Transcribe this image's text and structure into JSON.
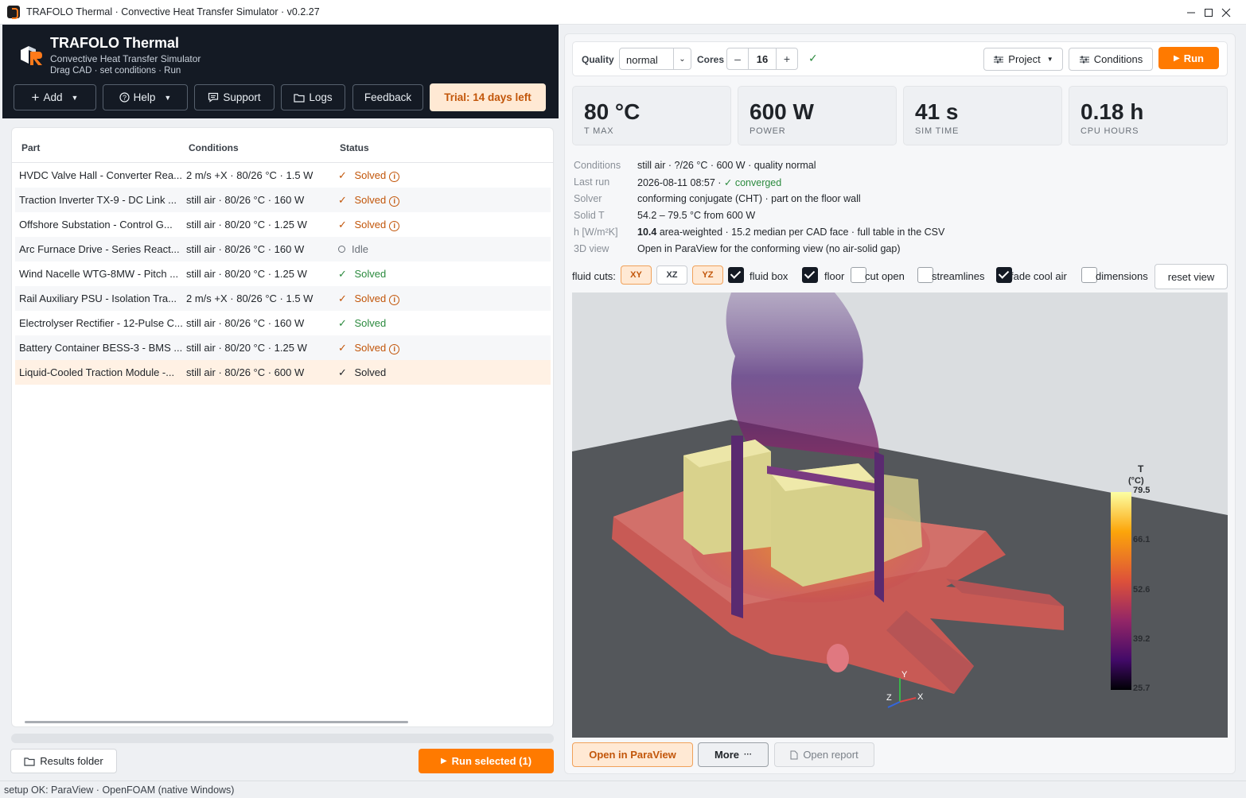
{
  "window": {
    "title": "TRAFOLO Thermal · Convective Heat Transfer Simulator · v0.2.27"
  },
  "header": {
    "app_name": "TRAFOLO Thermal",
    "subtitle": "Convective Heat Transfer Simulator",
    "tagline": "Drag CAD · set conditions · Run",
    "buttons": {
      "add": "Add",
      "help": "Help",
      "support": "Support",
      "logs": "Logs",
      "feedback": "Feedback",
      "trial": "Trial: 14 days left"
    }
  },
  "table": {
    "columns": [
      "Part",
      "Conditions",
      "Status"
    ],
    "rows": [
      {
        "part": "HVDC Valve Hall - Converter Rea...",
        "conditions": "2 m/s +X · 80/26 °C · 1.5 W",
        "status": "Solved",
        "kind": "warn"
      },
      {
        "part": "Traction Inverter TX-9 - DC Link ...",
        "conditions": "still air · 80/26 °C · 160 W",
        "status": "Solved",
        "kind": "warn"
      },
      {
        "part": "Offshore Substation - Control G...",
        "conditions": "still air · 80/20 °C · 1.25 W",
        "status": "Solved",
        "kind": "warn"
      },
      {
        "part": "Arc Furnace Drive - Series React...",
        "conditions": "still air · 80/26 °C · 160 W",
        "status": "Idle",
        "kind": "idle"
      },
      {
        "part": "Wind Nacelle WTG-8MW - Pitch ...",
        "conditions": "still air · 80/20 °C · 1.25 W",
        "status": "Solved",
        "kind": "ok"
      },
      {
        "part": "Rail Auxiliary PSU - Isolation Tra...",
        "conditions": "2 m/s +X · 80/26 °C · 1.5 W",
        "status": "Solved",
        "kind": "warn"
      },
      {
        "part": "Electrolyser Rectifier - 12-Pulse C...",
        "conditions": "still air · 80/26 °C · 160 W",
        "status": "Solved",
        "kind": "ok"
      },
      {
        "part": "Battery Container BESS-3 - BMS ...",
        "conditions": "still air · 80/20 °C · 1.25 W",
        "status": "Solved",
        "kind": "warn"
      },
      {
        "part": "Liquid-Cooled Traction Module -...",
        "conditions": "still air · 80/26 °C · 600 W",
        "status": "Solved",
        "kind": "selected"
      }
    ]
  },
  "left_footer": {
    "results_folder": "Results folder",
    "run_selected": "Run selected (1)"
  },
  "toolbar": {
    "quality_label": "Quality",
    "quality_value": "normal",
    "cores_label": "Cores",
    "cores_value": "16",
    "minus": "–",
    "plus": "+",
    "project": "Project",
    "conditions": "Conditions",
    "run": "Run"
  },
  "metrics": [
    {
      "value": "80 °C",
      "label": "T MAX"
    },
    {
      "value": "600 W",
      "label": "POWER"
    },
    {
      "value": "41 s",
      "label": "SIM TIME"
    },
    {
      "value": "0.18 h",
      "label": "CPU HOURS"
    }
  ],
  "details": {
    "conditions_k": "Conditions",
    "conditions_v": "still air · ?/26 °C · 600 W · quality normal",
    "lastrun_k": "Last run",
    "lastrun_v": "2026-08-11 08:57 ·",
    "lastrun_status": "✓ converged",
    "solver_k": "Solver",
    "solver_v": "conforming conjugate (CHT) · part on the floor wall",
    "solidt_k": "Solid T",
    "solidt_v": "54.2 – 79.5 °C from 600 W",
    "h_k": "h [W/m²K]",
    "h_bold": "10.4",
    "h_v": " area-weighted · 15.2 median per CAD face · full table in the CSV",
    "view_k": "3D view",
    "view_v": "Open in ParaView for the conforming view (no air-solid gap)"
  },
  "cuts": {
    "label": "fluid cuts:",
    "xy": "XY",
    "xz": "XZ",
    "yz": "YZ",
    "fluid_box": "fluid box",
    "floor": "floor",
    "cut_open": "cut open",
    "streamlines": "streamlines",
    "fade_cool_air": "fade cool air",
    "dimensions": "dimensions",
    "reset_view": "reset view"
  },
  "colorbar": {
    "title": "T",
    "unit": "(°C)",
    "ticks": [
      "79.5",
      "66.1",
      "52.6",
      "39.2",
      "25.7"
    ],
    "colors": [
      "#fcffa4",
      "#fca50a",
      "#dd513a",
      "#932667",
      "#420a68",
      "#000004"
    ]
  },
  "axes": {
    "x": "X",
    "y": "Y",
    "z": "Z"
  },
  "bottom": {
    "open_paraview": "Open in ParaView",
    "more": "More",
    "open_report": "Open report"
  },
  "statusbar": "setup OK: ParaView · OpenFOAM (native Windows)"
}
